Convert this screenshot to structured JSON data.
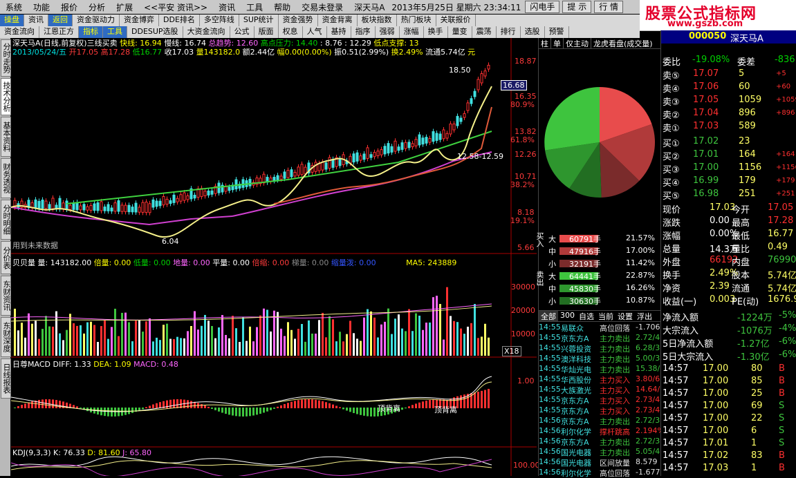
{
  "menu": [
    "系统",
    "功能",
    "报价",
    "分析",
    "扩展",
    "<<平安 资讯>>",
    "资讯",
    "工具",
    "帮助",
    "交易未登录",
    "深天马A",
    "2013年5月25日 星期六 23:34:11"
  ],
  "menu_buttons": [
    "闪电手",
    "提 示",
    "行 情"
  ],
  "logo": {
    "title": "股票公式指标网",
    "url": "www.gszb.com"
  },
  "toolbar1": [
    "操盘",
    "资讯",
    "返回",
    "资金驱动力",
    "资金博弈",
    "DDE排名",
    "多空阵线",
    "SUP统计",
    "资金强势",
    "资金背离",
    "板块指数",
    "热门板块",
    "关联报价"
  ],
  "toolbar2": [
    "资金流向",
    "江恩正方",
    "指标",
    "工具",
    "DDESUP选股",
    "大资金流向",
    "公式",
    "版面",
    "权息",
    "人气",
    "基持",
    "指序",
    "强弱",
    "涨幅",
    "换手",
    "量变",
    "震荡",
    "排行",
    "选股",
    "预警"
  ],
  "vtabs": [
    "分时走势",
    "技术分析",
    "基本资料",
    "财务透视",
    "分时明细",
    "分价表",
    "东财资讯",
    "东财深度",
    "日线报表"
  ],
  "kline": {
    "title_line1": "深天马A(日线,前复权)三线买卖",
    "fast": "快线: 16.94",
    "slow": "慢线: 16.74",
    "trend": "总趋势: 12.60",
    "resist": "高点压力: 14.40",
    "n1": ": 8.76",
    "n2": ": 12.29",
    "support": "低点支撑: 13",
    "date": "2013/05/24/五",
    "open": "开17.05",
    "high": "高17.28",
    "low": "低16.77",
    "close": "收17.03",
    "vol": "量143182.0",
    "amt": "额2.44亿",
    "amp": "幅0.00(0.00%)",
    "swing": "振0.51(2.99%)",
    "turn": "换2.49%",
    "flow": "流通5.74亿",
    "unit": "元",
    "prices": [
      "18.87",
      "16.68",
      "16.35",
      "80.9%",
      "13.82",
      "61.8%",
      "12.26",
      "10.71",
      "38.2%",
      "8.18",
      "19.1%",
      "5.66"
    ],
    "high_label": "18.50",
    "low_label": "6.04",
    "range_label": "12.58-12.59",
    "future": "用到未来数据"
  },
  "volume": {
    "title": "贝贝量",
    "vol": "量: 143182.00",
    "bei": "倍量: 0.00",
    "di": "低量: 0.00",
    "di2": "地量: 0.00",
    "ping": "平量: 0.00",
    "bl": "倍缩: 0.00",
    "ti": "梯量: 0.00",
    "sx": "缩量泼: 0.00",
    "ma5": "MA5: 243889",
    "axis": [
      "30000",
      "20000",
      "10000"
    ],
    "mult": "X18"
  },
  "macd": {
    "title": "日尊MACD",
    "diff": "DIFF: 1.33",
    "dea": "DEA: 1.09",
    "macd": "MACD: 0.48",
    "axis": "1.00",
    "div1": "顶背离",
    "div2": "顶背离"
  },
  "kdj": {
    "title": "KDJ(9,3,3)",
    "k": "K: 76.33",
    "d": "D: 81.60",
    "j": "J: 65.80",
    "axis": "100.00"
  },
  "tabs_panel": [
    "柱",
    "单",
    "仅主动",
    "龙虎看盘(成交量)"
  ],
  "flows": {
    "buy_label": "买入",
    "sell_label": "卖出",
    "rows": [
      {
        "side": "大",
        "vol": "60791手",
        "pct": "21.57%",
        "color": "#e84c4c"
      },
      {
        "side": "中",
        "vol": "47916手",
        "pct": "17.00%",
        "color": "#b03a3a"
      },
      {
        "side": "小",
        "vol": "32191手",
        "pct": "11.42%",
        "color": "#7a2b2b"
      },
      {
        "side": "大",
        "vol": "64441手",
        "pct": "22.87%",
        "color": "#3ec43e"
      },
      {
        "side": "中",
        "vol": "45830手",
        "pct": "16.26%",
        "color": "#2e962e"
      },
      {
        "side": "小",
        "vol": "30630手",
        "pct": "10.87%",
        "color": "#226e22"
      }
    ]
  },
  "ticker_tabs": [
    "全部",
    "300",
    "自选",
    "当前",
    "设置",
    "浮出"
  ],
  "ticker": [
    {
      "t": "14:55",
      "n": "易联众",
      "a": "高位回落",
      "v": "-1.706"
    },
    {
      "t": "14:55",
      "n": "京东方A",
      "a": "主力卖出",
      "v": "2.72/4"
    },
    {
      "t": "14:55",
      "n": "兴蓉投资",
      "a": "主力卖出",
      "v": "6.28/3"
    },
    {
      "t": "14:55",
      "n": "澳洋科技",
      "a": "主力卖出",
      "v": "5.00/3"
    },
    {
      "t": "14:55",
      "n": "华灿光电",
      "a": "主力卖出",
      "v": "15.38/"
    },
    {
      "t": "14:55",
      "n": "华西股份",
      "a": "主力买入",
      "v": "3.80/6"
    },
    {
      "t": "14:55",
      "n": "大族激光",
      "a": "主力买入",
      "v": "14.64/"
    },
    {
      "t": "14:55",
      "n": "京东方A",
      "a": "主力买入",
      "v": "2.73/4"
    },
    {
      "t": "14:55",
      "n": "京东方A",
      "a": "主力买入",
      "v": "2.73/4"
    },
    {
      "t": "14:56",
      "n": "京东方A",
      "a": "主力卖出",
      "v": "2.72/3"
    },
    {
      "t": "14:56",
      "n": "利尔化学",
      "a": "撑杆跳高",
      "v": "2.194%"
    },
    {
      "t": "14:56",
      "n": "京东方A",
      "a": "主力卖出",
      "v": "2.72/3"
    },
    {
      "t": "14:56",
      "n": "国光电器",
      "a": "主力卖出",
      "v": "5.05/4"
    },
    {
      "t": "14:56",
      "n": "国光电器",
      "a": "区间放量",
      "v": "8.579"
    },
    {
      "t": "14:56",
      "n": "利尔化学",
      "a": "高位回落",
      "v": "-1.677"
    }
  ],
  "quote": {
    "code": "000050",
    "name": "深天马A",
    "weibi": "委比",
    "weibi_v": "-19.08%",
    "weicha": "委差",
    "weicha_v": "-836",
    "sell": [
      {
        "l": "卖⑤",
        "p": "17.07",
        "v": "5",
        "d": "+5"
      },
      {
        "l": "卖④",
        "p": "17.06",
        "v": "60",
        "d": "+60"
      },
      {
        "l": "卖③",
        "p": "17.05",
        "v": "1059",
        "d": "+1059"
      },
      {
        "l": "卖②",
        "p": "17.04",
        "v": "896",
        "d": "+896"
      },
      {
        "l": "卖①",
        "p": "17.03",
        "v": "589",
        "d": ""
      }
    ],
    "buy": [
      {
        "l": "买①",
        "p": "17.02",
        "v": "23",
        "d": ""
      },
      {
        "l": "买②",
        "p": "17.01",
        "v": "164",
        "d": "+164"
      },
      {
        "l": "买③",
        "p": "17.00",
        "v": "1156",
        "d": "+1156"
      },
      {
        "l": "买④",
        "p": "16.99",
        "v": "179",
        "d": "+179"
      },
      {
        "l": "买⑤",
        "p": "16.98",
        "v": "251",
        "d": "+251"
      }
    ],
    "stats": [
      {
        "a": "现价",
        "av": "17.03",
        "b": "今开",
        "bv": "17.05"
      },
      {
        "a": "涨跌",
        "av": "0.00",
        "b": "最高",
        "bv": "17.28"
      },
      {
        "a": "涨幅",
        "av": "0.00%",
        "b": "最低",
        "bv": "16.77"
      },
      {
        "a": "总量",
        "av": "14.3万",
        "b": "量比",
        "bv": "0.49"
      },
      {
        "a": "外盘",
        "av": "66192",
        "b": "内盘",
        "bv": "76990"
      },
      {
        "a": "换手",
        "av": "2.49%",
        "b": "股本",
        "bv": "5.74亿"
      },
      {
        "a": "净资",
        "av": "2.39",
        "b": "流通",
        "bv": "5.74亿"
      },
      {
        "a": "收益(一)",
        "av": "0.003",
        "b": "PE(动)",
        "bv": "1676.9"
      }
    ],
    "fund": [
      {
        "l": "净流入额",
        "v": "-1224万",
        "p": "-5%"
      },
      {
        "l": "大宗流入",
        "v": "-1076万",
        "p": "-4%"
      },
      {
        "l": "5日净流入额",
        "v": "-1.27亿",
        "p": "-6%"
      },
      {
        "l": "5日大宗流入",
        "v": "-1.30亿",
        "p": "-6%"
      }
    ],
    "ticks": [
      {
        "t": "14:57",
        "p": "17.00",
        "v": "80",
        "s": "B"
      },
      {
        "t": "14:57",
        "p": "17.00",
        "v": "85",
        "s": "B"
      },
      {
        "t": "14:57",
        "p": "17.00",
        "v": "25",
        "s": "B"
      },
      {
        "t": "14:57",
        "p": "17.00",
        "v": "69",
        "s": "S"
      },
      {
        "t": "14:57",
        "p": "17.00",
        "v": "22",
        "s": "S"
      },
      {
        "t": "14:57",
        "p": "17.00",
        "v": "6",
        "s": "S"
      },
      {
        "t": "14:57",
        "p": "17.01",
        "v": "1",
        "s": "S"
      },
      {
        "t": "14:57",
        "p": "17.02",
        "v": "83",
        "s": "B"
      },
      {
        "t": "14:57",
        "p": "17.03",
        "v": "1",
        "s": "B"
      }
    ]
  }
}
